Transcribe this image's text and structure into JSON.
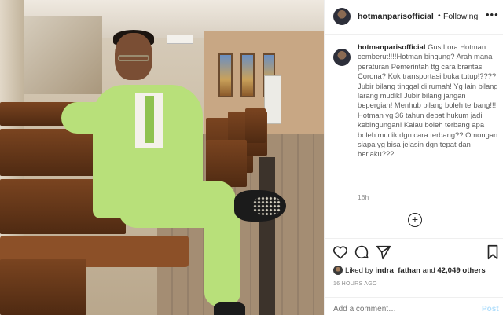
{
  "post": {
    "username": "hotmanparisofficial",
    "follow_state": "Following",
    "more_label": "•••",
    "caption_user": "hotmanparisofficial",
    "caption_text": "Gus Lora Hotman cemberut!!!!Hotman bingung? Arah mana peraturan Pemerintah ttg cara brantas Corona? Kok transportasi buka tutup!???? Jubir bilang tinggal di rumah! Yg lain bilang larang mudik! Jubir bilang jangan bepergian! Menhub bilang boleh terbang!!! Hotman yg 36 tahun debat hukum jadi kebingungan! Kalau boleh terbang apa boleh mudik dgn cara terbang?? Omongan siapa yg bisa jelasin dgn tepat dan berlaku???",
    "caption_time": "16h",
    "liked_by_prefix": "Liked by ",
    "liked_by_user": "indra_fathan",
    "liked_by_and": " and ",
    "likes_count": "42,049 others",
    "posted_ago": "16 HOURS AGO",
    "comment_placeholder": "Add a comment…",
    "post_label": "Post"
  },
  "icons": {
    "more": "more-dots-icon",
    "add": "plus-circle-icon",
    "like": "heart-icon",
    "comment": "comment-bubble-icon",
    "share": "paper-plane-icon",
    "save": "bookmark-icon"
  },
  "colors": {
    "text": "#262626",
    "muted": "#8e8e8e",
    "post_disabled": "#b2dffc",
    "suit": "#b8e07a"
  }
}
